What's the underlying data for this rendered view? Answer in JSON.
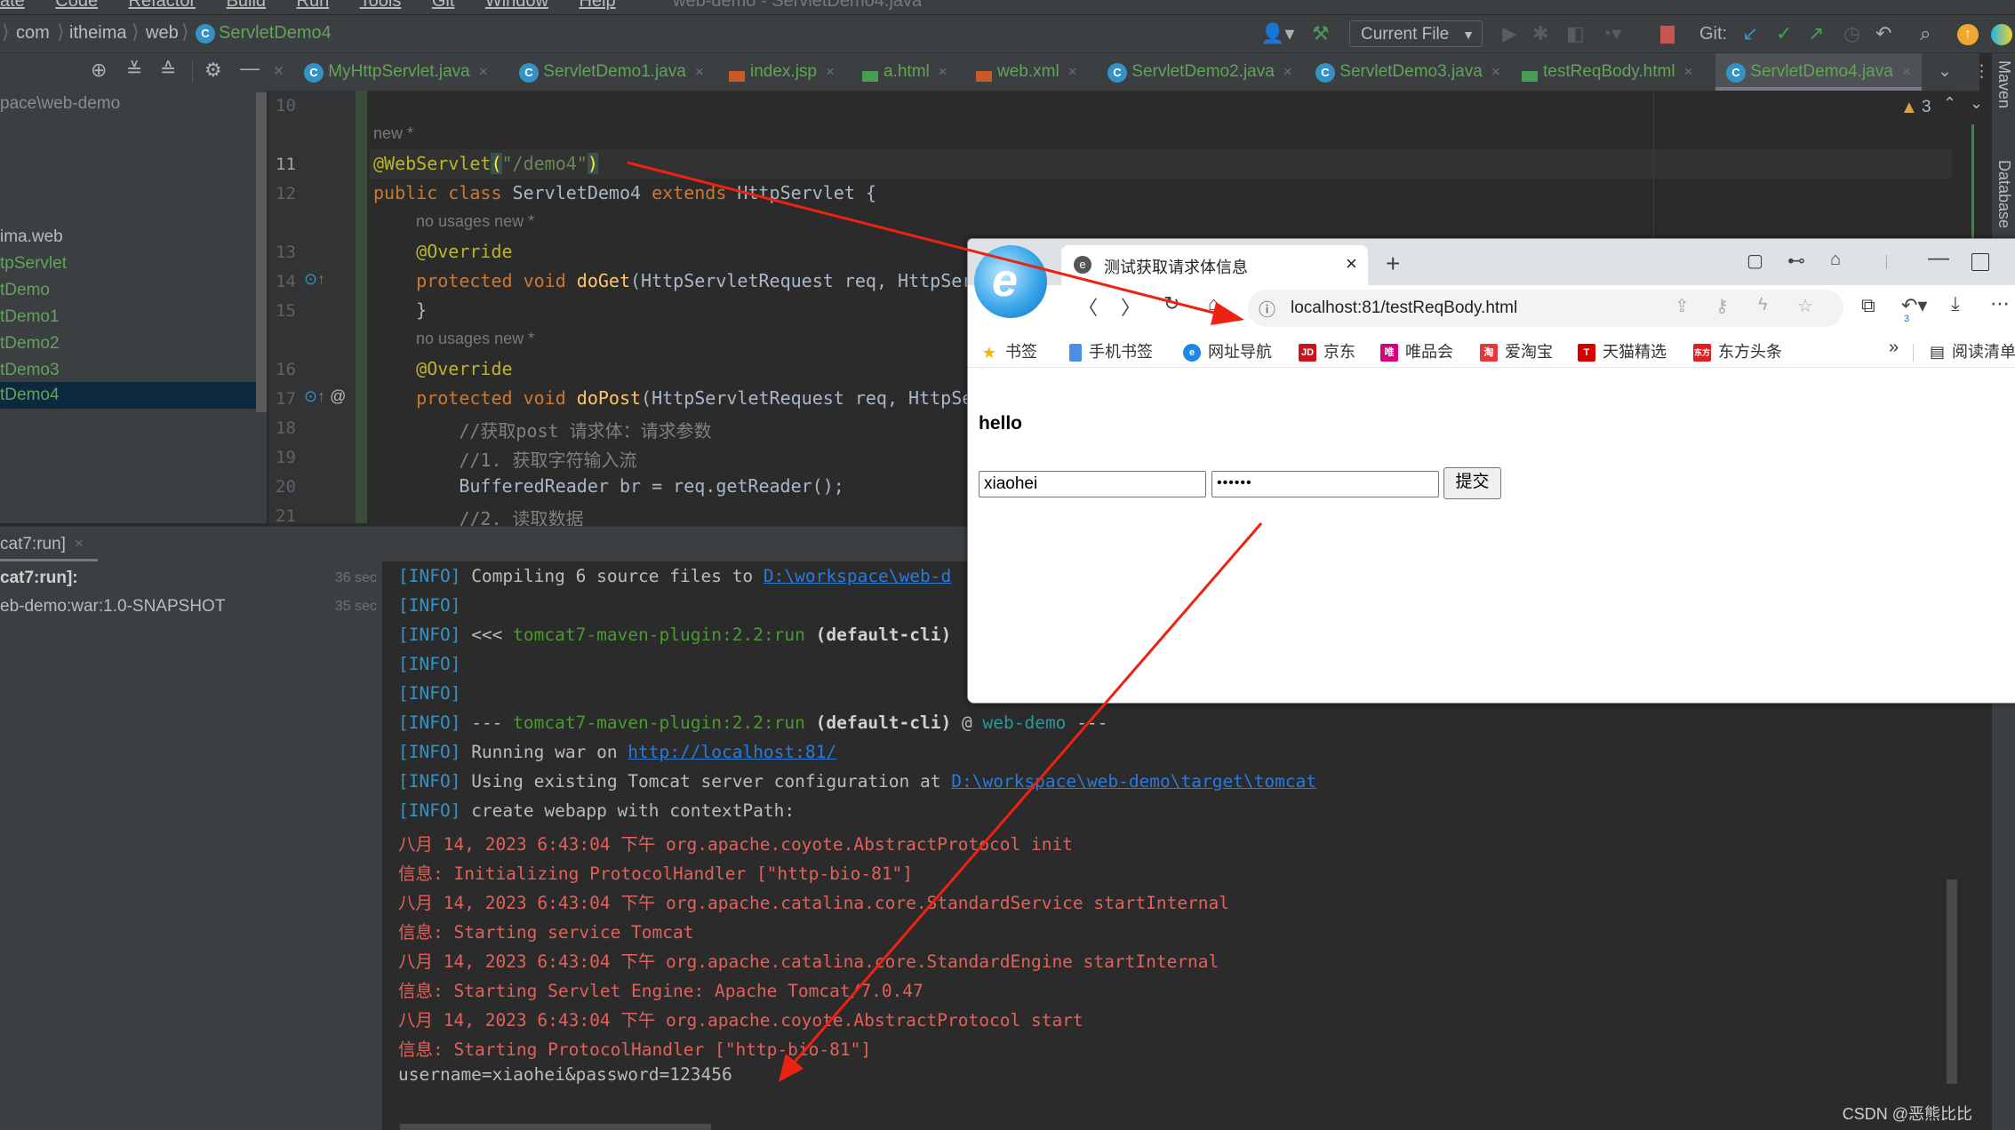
{
  "menu": {
    "items": [
      "ate",
      "Code",
      "Refactor",
      "Build",
      "Run",
      "Tools",
      "Git",
      "Window",
      "Help"
    ],
    "window_title": "web-demo - ServletDemo4.java"
  },
  "breadcrumb": [
    "com",
    "itheima",
    "web",
    "ServletDemo4"
  ],
  "toolbar": {
    "run_config": "Current File",
    "git_label": "Git:"
  },
  "tabs": [
    {
      "label": "MyHttpServlet.java",
      "type": "java"
    },
    {
      "label": "ServletDemo1.java",
      "type": "java"
    },
    {
      "label": "index.jsp",
      "type": "jsp"
    },
    {
      "label": "a.html",
      "type": "html"
    },
    {
      "label": "web.xml",
      "type": "xml"
    },
    {
      "label": "ServletDemo2.java",
      "type": "java"
    },
    {
      "label": "ServletDemo3.java",
      "type": "java"
    },
    {
      "label": "testReqBody.html",
      "type": "html"
    },
    {
      "label": "ServletDemo4.java",
      "type": "java",
      "active": true
    }
  ],
  "project_tree": {
    "root": "pace\\web-demo",
    "items": [
      "ima.web",
      "tpServlet",
      "tDemo",
      "tDemo1",
      "tDemo2",
      "tDemo3",
      "tDemo4"
    ],
    "selected": "tDemo4"
  },
  "editor": {
    "warnings_count": "3",
    "lines": [
      {
        "num": "10",
        "text": ""
      },
      {
        "hint": "new *"
      },
      {
        "num": "11",
        "tokens": [
          [
            "ann",
            "@WebServlet"
          ],
          [
            "",
            "("
          ],
          [
            "str",
            "\"/demo4\""
          ],
          [
            "",
            ")"
          ]
        ]
      },
      {
        "num": "12",
        "tokens": [
          [
            "kw",
            "public class "
          ],
          [
            "",
            "ServletDemo4 "
          ],
          [
            "kw",
            "extends "
          ],
          [
            "",
            "HttpServlet {"
          ]
        ]
      },
      {
        "hint": "no usages   new *"
      },
      {
        "num": "13",
        "tokens": [
          [
            "ann",
            "    @Override"
          ]
        ]
      },
      {
        "num": "14",
        "tokens": [
          [
            "kw",
            "    protected void "
          ],
          [
            "fn",
            "doGet"
          ],
          [
            "",
            "(HttpServletRequest req, HttpSer"
          ]
        ]
      },
      {
        "num": "15",
        "tokens": [
          [
            "",
            "    }"
          ]
        ]
      },
      {
        "hint": "no usages   new *"
      },
      {
        "num": "16",
        "tokens": [
          [
            "ann",
            "    @Override"
          ]
        ]
      },
      {
        "num": "17",
        "tokens": [
          [
            "kw",
            "    protected void "
          ],
          [
            "fn",
            "doPost"
          ],
          [
            "",
            "(HttpServletRequest req, HttpSe"
          ]
        ]
      },
      {
        "num": "18",
        "tokens": [
          [
            "cm",
            "        //获取post 请求体：请求参数"
          ]
        ]
      },
      {
        "num": "19",
        "tokens": [
          [
            "cm",
            "        //1. 获取字符输入流"
          ]
        ]
      },
      {
        "num": "20",
        "tokens": [
          [
            "",
            "        BufferedReader br = req.getReader();"
          ]
        ]
      },
      {
        "num": "21",
        "tokens": [
          [
            "cm",
            "        //2. 读取数据"
          ]
        ]
      }
    ]
  },
  "run_panel": {
    "tab_label": "cat7:run]",
    "tree": [
      {
        "label": "cat7:run]:",
        "time": "36 sec"
      },
      {
        "label": "eb-demo:war:1.0-SNAPSHOT",
        "time": "35 sec"
      }
    ],
    "console": [
      [
        [
          "info",
          "[INFO]"
        ],
        [
          "",
          " Compiling 6 source files to "
        ],
        [
          "link",
          "D:\\workspace\\web-d"
        ]
      ],
      [
        [
          "info",
          "[INFO]"
        ]
      ],
      [
        [
          "info",
          "[INFO]"
        ],
        [
          "",
          " <<< "
        ],
        [
          "plug",
          "tomcat7-maven-plugin:2.2:run"
        ],
        [
          "bold",
          " (default-cli)"
        ]
      ],
      [
        [
          "info",
          "[INFO]"
        ]
      ],
      [
        [
          "info",
          "[INFO]"
        ]
      ],
      [
        [
          "info",
          "[INFO]"
        ],
        [
          "",
          " --- "
        ],
        [
          "plug",
          "tomcat7-maven-plugin:2.2:run"
        ],
        [
          "bold",
          " (default-cli)"
        ],
        [
          "",
          " @ "
        ],
        [
          "teal",
          "web-demo"
        ],
        [
          "",
          " ---"
        ]
      ],
      [
        [
          "info",
          "[INFO]"
        ],
        [
          "",
          " Running war on "
        ],
        [
          "link",
          "http://localhost:81/"
        ]
      ],
      [
        [
          "info",
          "[INFO]"
        ],
        [
          "",
          " Using existing Tomcat server configuration at "
        ],
        [
          "link",
          "D:\\workspace\\web-demo\\target\\tomcat"
        ]
      ],
      [
        [
          "info",
          "[INFO]"
        ],
        [
          "",
          " create webapp with contextPath:"
        ]
      ],
      [
        [
          "err",
          "八月 14, 2023 6:43:04 下午 org.apache.coyote.AbstractProtocol init"
        ]
      ],
      [
        [
          "err",
          "信息: Initializing ProtocolHandler [\"http-bio-81\"]"
        ]
      ],
      [
        [
          "err",
          "八月 14, 2023 6:43:04 下午 org.apache.catalina.core.StandardService startInternal"
        ]
      ],
      [
        [
          "err",
          "信息: Starting service Tomcat"
        ]
      ],
      [
        [
          "err",
          "八月 14, 2023 6:43:04 下午 org.apache.catalina.core.StandardEngine startInternal"
        ]
      ],
      [
        [
          "err",
          "信息: Starting Servlet Engine: Apache Tomcat/7.0.47"
        ]
      ],
      [
        [
          "err",
          "八月 14, 2023 6:43:04 下午 org.apache.coyote.AbstractProtocol start"
        ]
      ],
      [
        [
          "err",
          "信息: Starting ProtocolHandler [\"http-bio-81\"]"
        ]
      ],
      [
        [
          "",
          "username=xiaohei&password=123456"
        ]
      ]
    ]
  },
  "right_strip": [
    "Maven",
    "Database"
  ],
  "browser": {
    "tab_title": "测试获取请求体信息",
    "url": "localhost:81/testReqBody.html",
    "undo_badge": "3",
    "bookmarks": [
      {
        "label": "书签",
        "color": "#f5b400",
        "glyph": "★"
      },
      {
        "label": "手机书签",
        "color": "#4a90e2",
        "glyph": "▯"
      },
      {
        "label": "网址导航",
        "color": "#1e88e5",
        "glyph": "e"
      },
      {
        "label": "京东",
        "color": "#c4161c",
        "glyph": "JD"
      },
      {
        "label": "唯品会",
        "color": "#d6007a",
        "glyph": "唯"
      },
      {
        "label": "爱淘宝",
        "color": "#e4393c",
        "glyph": "淘"
      },
      {
        "label": "天猫精选",
        "color": "#d50000",
        "glyph": "T"
      },
      {
        "label": "东方头条",
        "color": "#e02020",
        "glyph": "东方"
      }
    ],
    "more": "»",
    "reading_list": "阅读清单",
    "page": {
      "heading": "hello",
      "username_value": "xiaohei",
      "password_value": "••••••",
      "submit_label": "提交"
    }
  },
  "watermark": "CSDN @恶熊比比",
  "annotation_color": "#ee2211"
}
